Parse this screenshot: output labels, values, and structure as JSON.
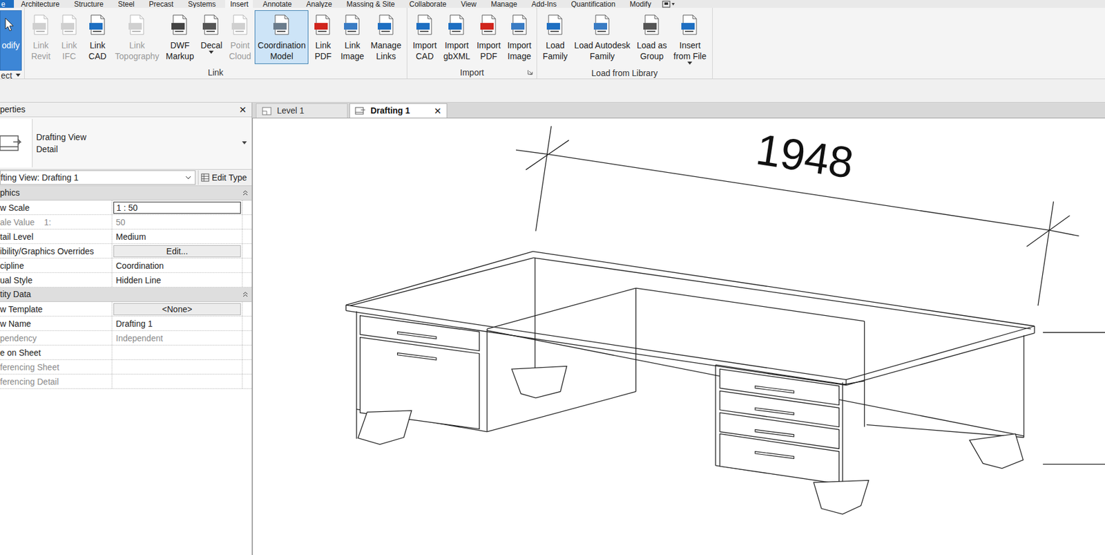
{
  "ribbon_tabs": [
    {
      "label": "e",
      "kind": "file",
      "selected": false
    },
    {
      "label": "Architecture",
      "kind": "tab",
      "selected": false
    },
    {
      "label": "Structure",
      "kind": "tab",
      "selected": false
    },
    {
      "label": "Steel",
      "kind": "tab",
      "selected": false
    },
    {
      "label": "Precast",
      "kind": "tab",
      "selected": false
    },
    {
      "label": "Systems",
      "kind": "tab",
      "selected": false
    },
    {
      "label": "Insert",
      "kind": "tab",
      "selected": true
    },
    {
      "label": "Annotate",
      "kind": "tab",
      "selected": false
    },
    {
      "label": "Analyze",
      "kind": "tab",
      "selected": false
    },
    {
      "label": "Massing & Site",
      "kind": "tab",
      "selected": false
    },
    {
      "label": "Collaborate",
      "kind": "tab",
      "selected": false
    },
    {
      "label": "View",
      "kind": "tab",
      "selected": false
    },
    {
      "label": "Manage",
      "kind": "tab",
      "selected": false
    },
    {
      "label": "Add-Ins",
      "kind": "tab",
      "selected": false
    },
    {
      "label": "Quantification",
      "kind": "tab",
      "selected": false
    },
    {
      "label": "Modify",
      "kind": "tab",
      "selected": false
    }
  ],
  "ribbon_panels": [
    {
      "label": "ect",
      "has_menu": true,
      "launcher": false,
      "buttons": [
        {
          "lines": [
            "odify"
          ],
          "selected": true,
          "disabled": false,
          "has_menu": false
        }
      ]
    },
    {
      "label": "Link",
      "has_menu": false,
      "launcher": false,
      "buttons": [
        {
          "lines": [
            "Link",
            "Revit"
          ],
          "selected": false,
          "disabled": true,
          "has_menu": false
        },
        {
          "lines": [
            "Link",
            "IFC"
          ],
          "selected": false,
          "disabled": true,
          "has_menu": false
        },
        {
          "lines": [
            "Link",
            "CAD"
          ],
          "selected": false,
          "disabled": false,
          "has_menu": false
        },
        {
          "lines": [
            "Link",
            "Topography"
          ],
          "selected": false,
          "disabled": true,
          "has_menu": false
        },
        {
          "lines": [
            "DWF",
            "Markup"
          ],
          "selected": false,
          "disabled": false,
          "has_menu": false
        },
        {
          "lines": [
            "Decal"
          ],
          "selected": false,
          "disabled": false,
          "has_menu": true
        },
        {
          "lines": [
            "Point",
            "Cloud"
          ],
          "selected": false,
          "disabled": true,
          "has_menu": false
        },
        {
          "lines": [
            "Coordination",
            "Model"
          ],
          "selected": true,
          "disabled": false,
          "has_menu": false
        },
        {
          "lines": [
            "Link",
            "PDF"
          ],
          "selected": false,
          "disabled": false,
          "has_menu": false
        },
        {
          "lines": [
            "Link",
            "Image"
          ],
          "selected": false,
          "disabled": false,
          "has_menu": false
        },
        {
          "lines": [
            "Manage",
            "Links"
          ],
          "selected": false,
          "disabled": false,
          "has_menu": false
        }
      ]
    },
    {
      "label": "Import",
      "has_menu": false,
      "launcher": true,
      "buttons": [
        {
          "lines": [
            "Import",
            "CAD"
          ],
          "selected": false,
          "disabled": false,
          "has_menu": false
        },
        {
          "lines": [
            "Import",
            "gbXML"
          ],
          "selected": false,
          "disabled": false,
          "has_menu": false
        },
        {
          "lines": [
            "Import",
            "PDF"
          ],
          "selected": false,
          "disabled": false,
          "has_menu": false
        },
        {
          "lines": [
            "Import",
            "Image"
          ],
          "selected": false,
          "disabled": false,
          "has_menu": false
        }
      ]
    },
    {
      "label": "Load from Library",
      "has_menu": false,
      "launcher": false,
      "buttons": [
        {
          "lines": [
            "Load",
            "Family"
          ],
          "selected": false,
          "disabled": false,
          "has_menu": false
        },
        {
          "lines": [
            "Load Autodesk",
            "Family"
          ],
          "selected": false,
          "disabled": false,
          "has_menu": false
        },
        {
          "lines": [
            "Load as",
            "Group"
          ],
          "selected": false,
          "disabled": false,
          "has_menu": false
        },
        {
          "lines": [
            "Insert",
            "from File"
          ],
          "selected": false,
          "disabled": false,
          "has_menu": true
        }
      ]
    }
  ],
  "properties": {
    "title": "perties",
    "close": "✕",
    "type_lines": [
      "Drafting View",
      "Detail"
    ],
    "instance": "fting View: Drafting 1",
    "edit_type": "Edit Type",
    "groups": [
      {
        "label": "phics",
        "expanded": true,
        "rows": [
          {
            "label": "w Scale",
            "value": "1 : 50",
            "kind": "field",
            "disabled": false
          },
          {
            "label": "ale Value    1:",
            "value": "50",
            "kind": "text",
            "disabled": true
          },
          {
            "label": "tail Level",
            "value": "Medium",
            "kind": "text",
            "disabled": false
          },
          {
            "label": "ibility/Graphics Overrides",
            "value": "Edit...",
            "kind": "button",
            "disabled": false
          },
          {
            "label": "cipline",
            "value": "Coordination",
            "kind": "text",
            "disabled": false
          },
          {
            "label": "ual Style",
            "value": "Hidden Line",
            "kind": "text",
            "disabled": false
          }
        ]
      },
      {
        "label": "tity Data",
        "expanded": true,
        "rows": [
          {
            "label": "w Template",
            "value": "<None>",
            "kind": "button",
            "disabled": false
          },
          {
            "label": "w Name",
            "value": "Drafting 1",
            "kind": "text",
            "disabled": false
          },
          {
            "label": "pendency",
            "value": "Independent",
            "kind": "text",
            "disabled": true
          },
          {
            "label": "e on Sheet",
            "value": "",
            "kind": "text",
            "disabled": false
          },
          {
            "label": "ferencing Sheet",
            "value": "",
            "kind": "text",
            "disabled": true
          },
          {
            "label": "ferencing Detail",
            "value": "",
            "kind": "text",
            "disabled": true
          }
        ]
      }
    ]
  },
  "view_tabs": [
    {
      "label": "Level 1",
      "selected": false,
      "closable": false
    },
    {
      "label": "Drafting 1",
      "selected": true,
      "closable": true
    }
  ],
  "view_tab_close": "✕",
  "drawing": {
    "dimension": "1948"
  }
}
